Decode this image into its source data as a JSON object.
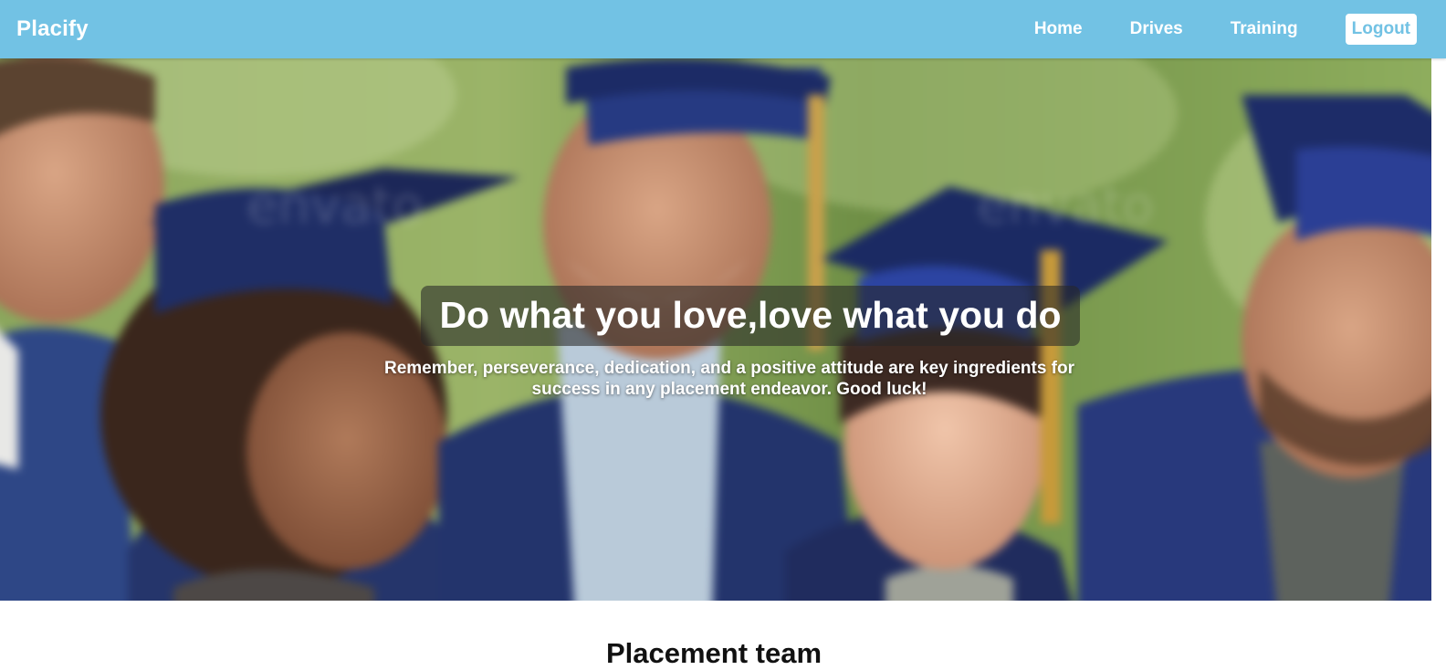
{
  "navbar": {
    "brand": "Placify",
    "links": [
      "Home",
      "Drives",
      "Training"
    ],
    "logout_label": "Logout"
  },
  "hero": {
    "title": "Do what you love,love what you do",
    "subtitle": "Remember, perseverance, dedication, and a positive attitude are key ingredients for success in any placement endeavor. Good luck!"
  },
  "section": {
    "heading": "Placement team"
  },
  "colors": {
    "navbar": "#72c2e4",
    "text_on_nav": "#ffffff",
    "gown": "#24366e",
    "background_foliage": "#7e9b4e"
  }
}
